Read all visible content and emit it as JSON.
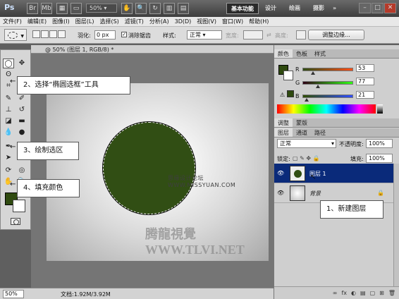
{
  "titlebar": {
    "logo": "Ps",
    "icons": [
      "Br",
      "Mb"
    ],
    "zoom": "50%",
    "workspaces": [
      "基本功能",
      "设计",
      "绘画",
      "摄影"
    ],
    "more": "»",
    "window_buttons": [
      "–",
      "□",
      "✕"
    ]
  },
  "menu": {
    "items": [
      "文件(F)",
      "编辑(E)",
      "图像(I)",
      "图层(L)",
      "选择(S)",
      "滤镜(T)",
      "分析(A)",
      "3D(D)",
      "视图(V)",
      "窗口(W)",
      "帮助(H)"
    ]
  },
  "options": {
    "feather_label": "羽化:",
    "feather_value": "0 px",
    "antialias_label": "消除锯齿",
    "antialias_checked": "✓",
    "style_label": "样式:",
    "style_value": "正常",
    "width_label": "宽度:",
    "height_label": "高度:",
    "refine_edge": "调整边缘..."
  },
  "document": {
    "tab_title": "@ 50% (图层 1, RGB/8) *",
    "zoom": "50%",
    "doc_info": "文档:1.92M/3.92M"
  },
  "watermarks": {
    "top": "思缘设计论坛 WWW.MISSYUAN.COM",
    "bottom": "腾龍視覺WWW.TLVI.NET"
  },
  "callouts": {
    "step1": "1、新建图层",
    "step2": "2、选择“椭圆选框”工具",
    "step3": "3、绘制选区",
    "step4": "4、填充颜色"
  },
  "color_panel": {
    "tabs": [
      "颜色",
      "色板",
      "样式"
    ],
    "channels": [
      {
        "label": "R",
        "value": "53",
        "pos": 0.21
      },
      {
        "label": "G",
        "value": "77",
        "pos": 0.3
      },
      {
        "label": "B",
        "value": "21",
        "pos": 0.08
      }
    ],
    "fg_color": "#2f4a10",
    "warning_icon": "⚠"
  },
  "adjust_panel": {
    "tabs": [
      "调整",
      "蒙版"
    ]
  },
  "layers_panel": {
    "tabs": [
      "图层",
      "通道",
      "路径"
    ],
    "blend_mode": "正常",
    "opacity_label": "不透明度:",
    "opacity_value": "100%",
    "lock_label": "锁定:",
    "fill_label": "填充:",
    "fill_value": "100%",
    "layers": [
      {
        "name": "图层 1",
        "active": true
      },
      {
        "name": "背景",
        "active": false,
        "locked": true
      }
    ],
    "bottom_icons": [
      "∞",
      "fx",
      "◐",
      "▤",
      "▢",
      "⊞",
      "🗑"
    ]
  }
}
